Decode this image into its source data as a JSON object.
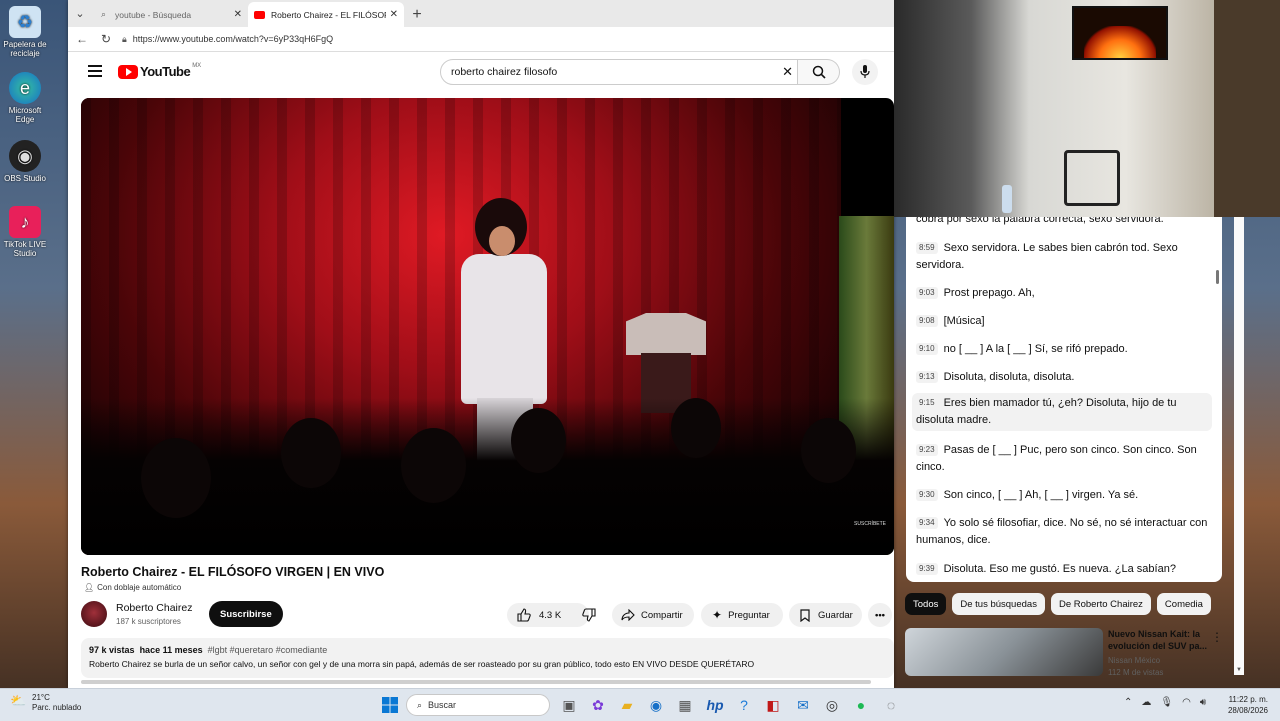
{
  "desktop": {
    "icons": [
      {
        "label": "Papelera de reciclaje",
        "icon": "recycle-bin-icon"
      },
      {
        "label": "Microsoft Edge",
        "icon": "edge-icon"
      },
      {
        "label": "OBS Studio",
        "icon": "obs-icon"
      },
      {
        "label": "TikTok LIVE Studio",
        "icon": "tiktok-icon"
      }
    ]
  },
  "browser": {
    "tabs": [
      {
        "label": "youtube - Búsqueda",
        "active": false
      },
      {
        "label": "Roberto Chairez - EL FILÓSOFO VIRGEN",
        "active": true
      }
    ],
    "url": "https://www.youtube.com/watch?v=6yP33qH6FgQ"
  },
  "youtube": {
    "logo_text": "YouTube",
    "region": "MX",
    "search_value": "roberto chairez filosofo",
    "video": {
      "watermark": "SUSCRÍBETE",
      "title": "Roberto Chairez - EL FILÓSOFO VIRGEN | EN VIVO",
      "dub_label": "Con doblaje automático",
      "channel": "Roberto Chairez",
      "subscribers": "187 k suscriptores",
      "subscribe_label": "Suscribirse",
      "likes": "4.3 K",
      "share_label": "Compartir",
      "ask_label": "Preguntar",
      "save_label": "Guardar",
      "views": "97 k vistas",
      "age": "hace 11 meses",
      "tags": "#lgbt #queretaro #comediante",
      "description": "Roberto Chairez se burla de un señor calvo, un señor con gel y de una morra sin papá, además de ser roasteado por su gran público, todo esto EN VIVO DESDE QUERÉTARO"
    },
    "transcript": [
      {
        "time": "",
        "text": "cobra por sexo la palabra correcta, sexo servidora."
      },
      {
        "time": "8:59",
        "text": "Sexo servidora. Le sabes bien cabrón tod. Sexo servidora."
      },
      {
        "time": "9:03",
        "text": "Prost prepago. Ah,"
      },
      {
        "time": "9:08",
        "text": "[Música]"
      },
      {
        "time": "9:10",
        "text": "no [ __ ] A la [ __ ] Sí, se rifó prepado."
      },
      {
        "time": "9:13",
        "text": "Disoluta, disoluta, disoluta."
      },
      {
        "time": "9:15",
        "text": "Eres bien mamador tú, ¿eh? Disoluta, hijo de tu disoluta madre."
      },
      {
        "time": "9:23",
        "text": "Pasas de [ __ ] Puc, pero son cinco. Son cinco. Son cinco."
      },
      {
        "time": "9:30",
        "text": "Son cinco, [ __ ] Ah, [ __ ] virgen. Ya sé."
      },
      {
        "time": "9:34",
        "text": "Yo solo sé filosofiar, dice. No sé, no sé interactuar con humanos, dice."
      },
      {
        "time": "9:39",
        "text": "Disoluta. Eso me gustó. Es nueva. ¿La sabían?"
      }
    ],
    "chips": [
      "Todos",
      "De tus búsquedas",
      "De Roberto Chairez",
      "Comedia"
    ],
    "recommendation": {
      "title": "Nuevo Nissan Kait: la evolución del SUV pa...",
      "channel": "Nissan México",
      "views": "112 M de vistas"
    }
  },
  "taskbar": {
    "weather_temp": "21°C",
    "weather_desc": "Parc. nublado",
    "search_placeholder": "Buscar",
    "time": "11:22 p. m.",
    "date": "28/08/2026"
  }
}
